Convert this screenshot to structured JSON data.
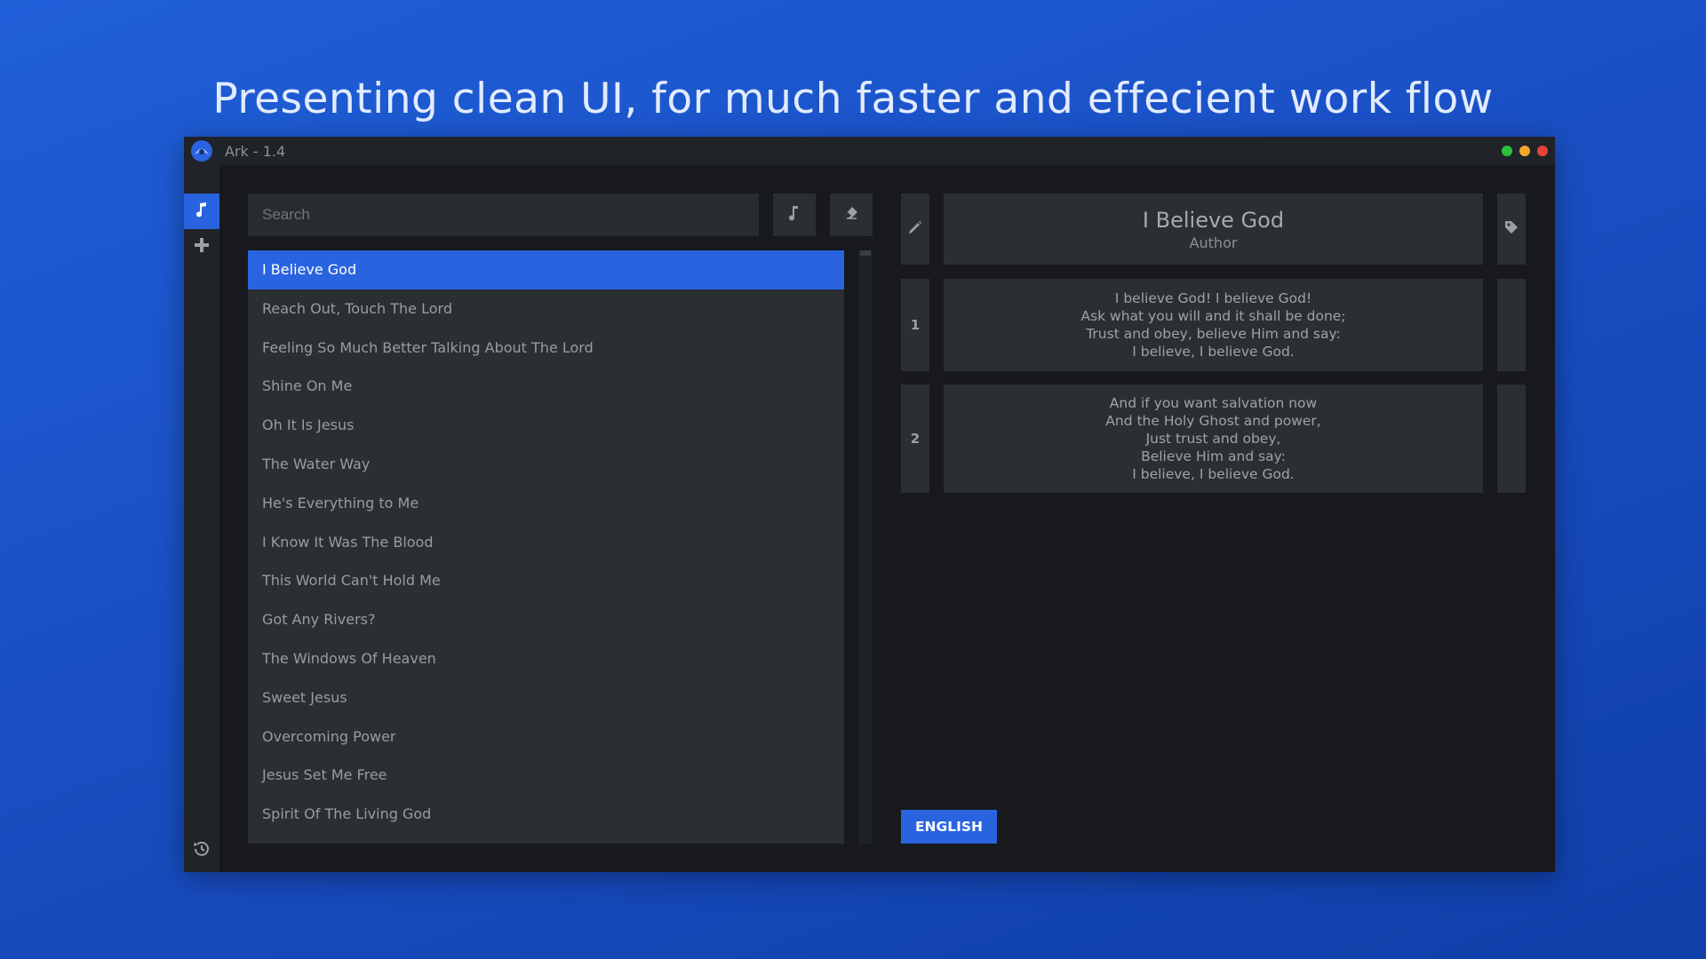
{
  "headline": "Presenting clean UI, for much faster and effecient work flow",
  "window": {
    "title": "Ark - 1.4",
    "controls": [
      "green",
      "orange",
      "red"
    ]
  },
  "rail": {
    "items": [
      {
        "icon": "music-note-icon",
        "active": true
      },
      {
        "icon": "plus-icon",
        "active": false
      },
      {
        "icon": "history-icon",
        "active": false
      }
    ]
  },
  "search": {
    "placeholder": "Search",
    "value": ""
  },
  "toolbar": {
    "music_icon": "music-note-icon",
    "eraser_icon": "eraser-icon"
  },
  "songs": [
    "I Believe God",
    "Reach Out, Touch The Lord",
    "Feeling So Much Better Talking About The Lord",
    "Shine On Me",
    "Oh It Is Jesus",
    "The Water Way",
    "He's Everything to Me",
    "I Know It Was The Blood",
    "This World Can't Hold Me",
    "Got Any Rivers?",
    "The Windows Of Heaven",
    "Sweet Jesus",
    "Overcoming Power",
    "Jesus Set Me Free",
    "Spirit Of The Living God"
  ],
  "selected_song_index": 0,
  "detail": {
    "title": "I Believe God",
    "author": "Author",
    "verses": [
      {
        "number": "1",
        "lines": [
          "I believe God! I believe God!",
          "Ask what you will and it shall be done;",
          "Trust and obey, believe Him and say:",
          "I believe, I believe God."
        ]
      },
      {
        "number": "2",
        "lines": [
          "And if you want salvation now",
          "And the Holy Ghost and power,",
          "Just trust and obey,",
          "Believe Him and say:",
          "I believe, I believe God."
        ]
      }
    ]
  },
  "language_button": "ENGLISH",
  "colors": {
    "accent": "#2a63e0",
    "panel": "#2b2e33",
    "background": "#17191d"
  }
}
